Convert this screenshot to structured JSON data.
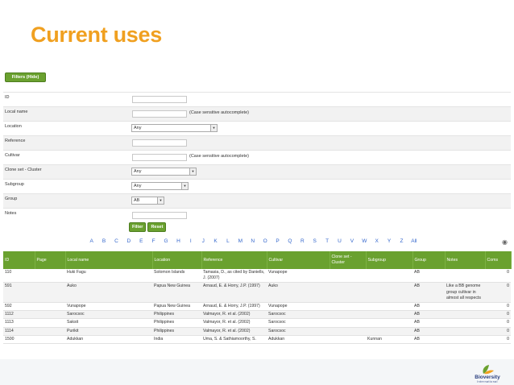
{
  "slide": {
    "title": "Current uses"
  },
  "filters_button": "Filters (Hide)",
  "form": {
    "id_label": "ID",
    "local_name_label": "Local name",
    "local_name_hint": "(Case sensitive autocomplete)",
    "location_label": "Location",
    "location_value": "Any",
    "reference_label": "Reference",
    "cultivar_label": "Cultivar",
    "cultivar_hint": "(Case sensitive autocomplete)",
    "clone_label": "Clone set - Cluster",
    "clone_value": "Any",
    "subgroup_label": "Subgroup",
    "subgroup_value": "Any",
    "group_label": "Group",
    "group_value": "AB",
    "notes_label": "Notes",
    "filter_button": "Filter",
    "reset_button": "Reset"
  },
  "alphabet": [
    "A",
    "B",
    "C",
    "D",
    "E",
    "F",
    "G",
    "H",
    "I",
    "J",
    "K",
    "L",
    "M",
    "N",
    "O",
    "P",
    "Q",
    "R",
    "S",
    "T",
    "U",
    "V",
    "W",
    "X",
    "Y",
    "Z",
    "All"
  ],
  "table": {
    "headers": [
      "ID",
      "Page",
      "Local name",
      "Location",
      "Reference",
      "Cultivar",
      "Clone set - Cluster",
      "Subgroup",
      "Group",
      "Notes",
      "Coms"
    ],
    "rows": [
      [
        "110",
        "",
        "Huki Fagu",
        "Solomon Islands",
        "Tamasia, D., as cited by Daniells, J. (2007)",
        "Vunapope",
        "",
        "",
        "AB",
        "",
        "0"
      ],
      [
        "591",
        "",
        "Auko",
        "Papua New Guinea",
        "Arnaud, E. & Horry, J.P. (1997)",
        "Auko",
        "",
        "",
        "AB",
        "Like a BB genome group cultivar in almost all respects",
        "0"
      ],
      [
        "592",
        "",
        "Vunapope",
        "Papua New Guinea",
        "Arnaud, E. & Horry, J.P. (1997)",
        "Vunapope",
        "",
        "",
        "AB",
        "",
        "0"
      ],
      [
        "1112",
        "",
        "Sarocsoc",
        "Philippines",
        "Valmayor, R. et al. (2002)",
        "Sarocsoc",
        "",
        "",
        "AB",
        "",
        "0"
      ],
      [
        "1113",
        "",
        "Saksit",
        "Philippines",
        "Valmayor, R. et al. (2002)",
        "Sarocsoc",
        "",
        "",
        "AB",
        "",
        "0"
      ],
      [
        "1114",
        "",
        "Purikit",
        "Philippines",
        "Valmayor, R. et al. (2002)",
        "Sarocsoc",
        "",
        "",
        "AB",
        "",
        "0"
      ],
      [
        "1500",
        "",
        "Adukkan",
        "India",
        "Uma, S. & Sathiamoorthy, S.",
        "Adukkan",
        "",
        "Kunnan",
        "AB",
        "",
        "0"
      ]
    ]
  },
  "logo": {
    "name": "Bioversity",
    "sub": "International"
  },
  "colors": {
    "accent": "#f0a020",
    "green": "#6aa12f",
    "link": "#3366cc"
  }
}
